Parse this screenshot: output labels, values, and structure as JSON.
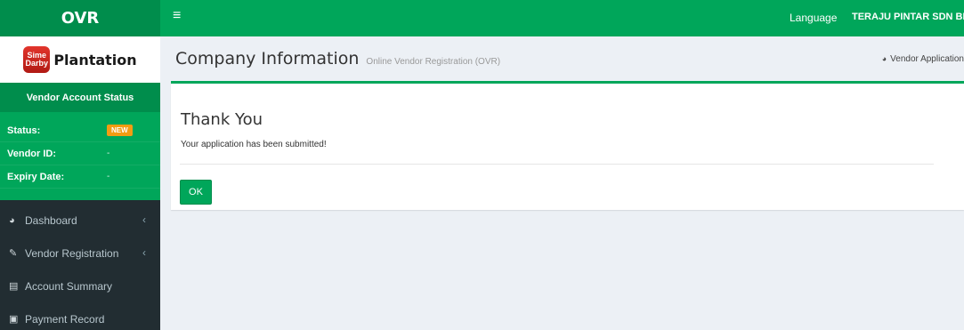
{
  "header": {
    "logo": "OVR",
    "menu_icon": "hamburger-icon",
    "language": "Language",
    "company": "TERAJU PINTAR SDN BHD"
  },
  "sidebar": {
    "brand": {
      "badge_line1": "Sime",
      "badge_line2": "Darby",
      "name": "Plantation"
    },
    "status_panel": {
      "title": "Vendor Account Status",
      "status_label": "Status:",
      "status_badge": "NEW",
      "vendor_id_label": "Vendor ID:",
      "vendor_id_value": "-",
      "expiry_label": "Expiry Date:",
      "expiry_value": "-"
    },
    "menu": [
      {
        "label": "Dashboard",
        "icon": "dashboard-icon",
        "has_chevron": true
      },
      {
        "label": "Vendor Registration",
        "icon": "edit-icon",
        "has_chevron": true
      },
      {
        "label": "Account Summary",
        "icon": "list-icon",
        "has_chevron": false
      },
      {
        "label": "Payment Record",
        "icon": "money-icon",
        "has_chevron": false
      }
    ]
  },
  "content": {
    "title": "Company Information",
    "subtitle": "Online Vendor Registration (OVR)",
    "breadcrumb": "Vendor Application",
    "box": {
      "heading": "Thank You",
      "message": "Your application has been submitted!",
      "ok_label": "OK"
    }
  },
  "colors": {
    "primary_green": "#00a65a",
    "dark_green": "#008d4c",
    "sidebar_bg": "#222d32",
    "badge_orange": "#f39c12",
    "page_bg": "#ecf0f5"
  }
}
